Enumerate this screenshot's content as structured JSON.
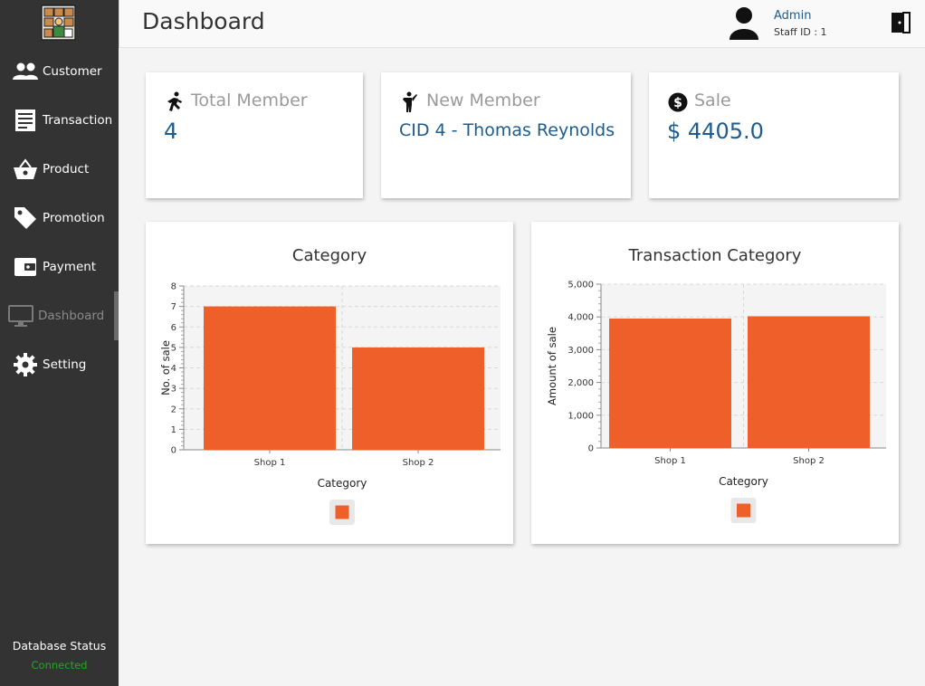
{
  "sidebar": {
    "items": [
      {
        "label": "Customer",
        "icon": "users-icon"
      },
      {
        "label": "Transaction",
        "icon": "receipt-icon"
      },
      {
        "label": "Product",
        "icon": "basket-icon"
      },
      {
        "label": "Promotion",
        "icon": "tag-icon"
      },
      {
        "label": "Payment",
        "icon": "wallet-icon"
      },
      {
        "label": "Dashboard",
        "icon": "monitor-icon"
      },
      {
        "label": "Setting",
        "icon": "gear-icon"
      }
    ],
    "active": "Dashboard",
    "db_status_label": "Database Status",
    "db_status_value": "Connected"
  },
  "header": {
    "title": "Dashboard",
    "user_name": "Admin",
    "staff_id": "Staff ID :  1"
  },
  "stats": {
    "total_member": {
      "label": "Total Member",
      "value": "4"
    },
    "new_member": {
      "label": "New Member",
      "value": "CID 4 - Thomas Reynolds"
    },
    "sale": {
      "label": "Sale",
      "value": "$ 4405.0"
    }
  },
  "colors": {
    "sidebar_bg": "#333333",
    "accent_text": "#1d5c8c",
    "bar": "#ee5f2a",
    "connected": "#1faa1f"
  },
  "chart_data": [
    {
      "type": "bar",
      "title": "Category",
      "xlabel": "Category",
      "ylabel": "No. of sale",
      "categories": [
        "Shop 1",
        "Shop 2"
      ],
      "values": [
        7,
        5
      ],
      "ylim": [
        0,
        8
      ],
      "yticks": [
        "0",
        "1",
        "2",
        "3",
        "4",
        "5",
        "6",
        "7",
        "8"
      ],
      "grid": true,
      "legend": "bottom"
    },
    {
      "type": "bar",
      "title": "Transaction Category",
      "xlabel": "Category",
      "ylabel": "Amount of sale",
      "categories": [
        "Shop 1",
        "Shop 2"
      ],
      "values": [
        3950,
        4020
      ],
      "ylim": [
        0,
        5000
      ],
      "yticks": [
        "0",
        "1,000",
        "2,000",
        "3,000",
        "4,000",
        "5,000"
      ],
      "grid": true,
      "legend": "bottom"
    }
  ]
}
